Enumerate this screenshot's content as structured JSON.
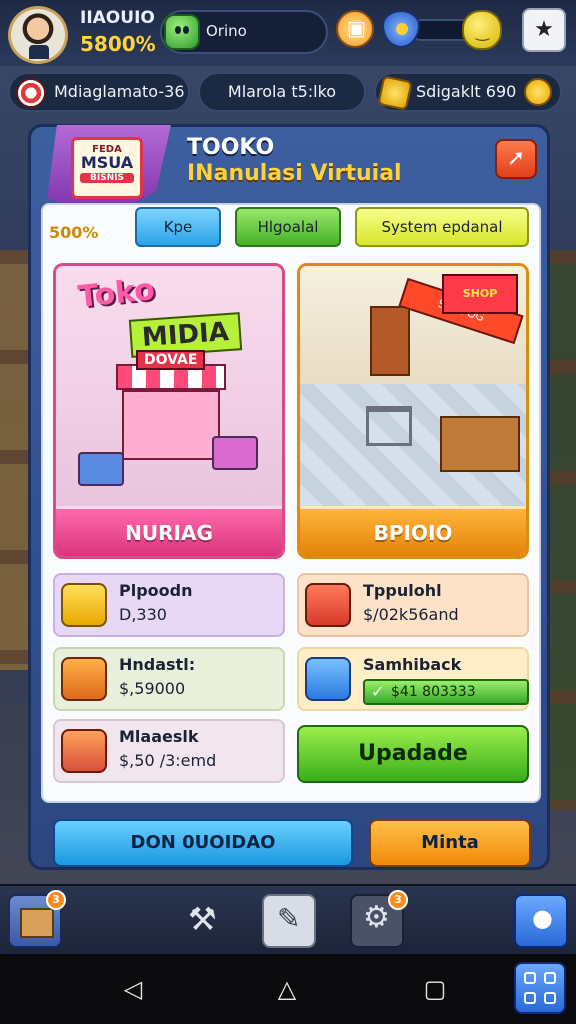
{
  "hud": {
    "player_name": "IIAOUIO",
    "player_percent": "5800%",
    "gem_value": "Orino"
  },
  "resources": {
    "left": "Mdiaglamato-36",
    "middle": "Mlarola t5:lko",
    "right": "Sdigaklt 690"
  },
  "panel": {
    "badge_line1": "FEDA",
    "badge_line2": "MSUA",
    "badge_line3": "BISNIS",
    "title": "TOOKO",
    "subtitle": "INanulasi Virtuial",
    "percent": "500%",
    "tabs": [
      "Kpe",
      "Hlgoalal",
      "System epdanal"
    ],
    "art_left_title": "Toko",
    "art_left_title2": "MIDIA",
    "art_left_stall_sign": "DOVAE",
    "art_right_banner": "SHOPOG",
    "art_right_sign": "SHOP",
    "card_left_label": "NURIAG",
    "card_right_label": "BPIOIO",
    "info": [
      {
        "title": "Plpoodn",
        "value": "D,330"
      },
      {
        "title": "Tppulohl",
        "value": "$/02k56and"
      },
      {
        "title": "Hndastl:",
        "value": "$,59000"
      },
      {
        "title": "Samhiback",
        "value": "$41 803333"
      },
      {
        "title": "Mlaaeslk",
        "value": "$,50 /3:emd"
      }
    ],
    "upgrade_label": "Upadade",
    "bottom_left_label": "DON 0UOIDAO",
    "bottom_right_label": "Minta"
  },
  "toolbar": {
    "box_badge": "3",
    "gear_badge": "3"
  },
  "colors": {
    "accent_yellow": "#ffd43b",
    "panel_blue": "#3d5fa0",
    "card_pink": "#d84a8a",
    "card_orange": "#e08a10",
    "upgrade_green": "#3aae1a"
  },
  "icons": [
    "avatar",
    "gem-icon",
    "shop-icon",
    "shield-icon",
    "lemon-icon",
    "star-icon",
    "candy-icon",
    "coin-icon",
    "smile-icon",
    "close-icon",
    "check-icon",
    "box-icon",
    "tool-icon",
    "note-icon",
    "gear-icon",
    "map-pin-icon",
    "back-icon",
    "home-icon",
    "recent-icon",
    "grid-icon"
  ]
}
